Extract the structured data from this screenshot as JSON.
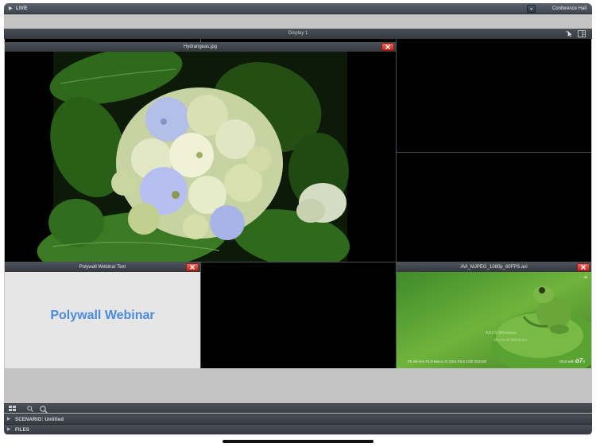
{
  "live_bar": {
    "title": "LIVE",
    "room": "Conference Hall"
  },
  "display": {
    "title": "Display 1"
  },
  "windows": {
    "image": {
      "title": "Hydrangeas.jpg"
    },
    "text": {
      "title": "Polywall Webinar Text",
      "content": "Polywall Webinar"
    },
    "video": {
      "title": "AVI_MJPEG_1080p_60FPS.avi",
      "caption_line1": "ASUS Windows",
      "caption_line2": "Microsoft Windows",
      "meta": "FE 90 mm  F2.8 Macro G OSS   F5.6   1/30   ISO100",
      "shot_prefix": "Shot with",
      "brand": "α7",
      "brand_suffix": "II"
    }
  },
  "sections": {
    "scenario": "SCENARIO: Untitled",
    "files": "FILES"
  },
  "colors": {
    "accent_text": "#4a8be0",
    "close_button": "#d03a2c"
  },
  "icons": {
    "live_toggle": "triangle-right-icon",
    "dropdown": "chevron-down-icon",
    "cursor": "cursor-icon",
    "layout": "layout-panel-icon",
    "close": "close-icon",
    "grid": "grid-icon",
    "zoom_out": "zoom-out-icon",
    "zoom_in": "zoom-in-icon"
  }
}
